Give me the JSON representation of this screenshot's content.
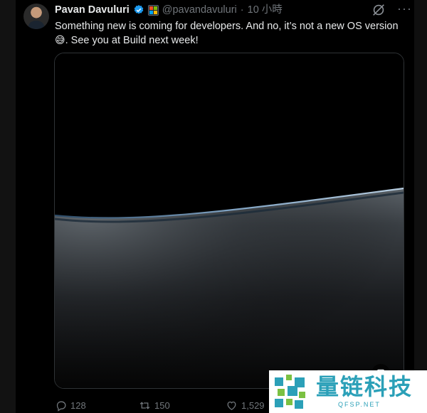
{
  "tweet": {
    "display_name": "Pavan Davuluri",
    "handle": "@pavandavuluri",
    "separator": "·",
    "timestamp": "10 小時",
    "text": "Something new is coming for developers. And no, it’s not a new OS version",
    "emoji": "😅",
    "text_cont": ". See you at Build next week!"
  },
  "icons": {
    "verified": "verified-badge-icon",
    "affiliate": "microsoft-affiliate-icon",
    "grok": "grok-icon",
    "more": "more-icon",
    "media": "media-expand-icon",
    "reply": "reply-icon",
    "retweet": "retweet-icon",
    "like": "like-icon"
  },
  "colors": {
    "accent_verified": "#1d9bf0",
    "text_primary": "#e7e9ea",
    "text_secondary": "#71767b",
    "watermark": "#2ba0b8"
  },
  "actions": {
    "replies": "128",
    "retweets": "150",
    "likes": "1,529"
  },
  "watermark": {
    "title": "量链科技",
    "subtitle": "QFSP.NET"
  }
}
